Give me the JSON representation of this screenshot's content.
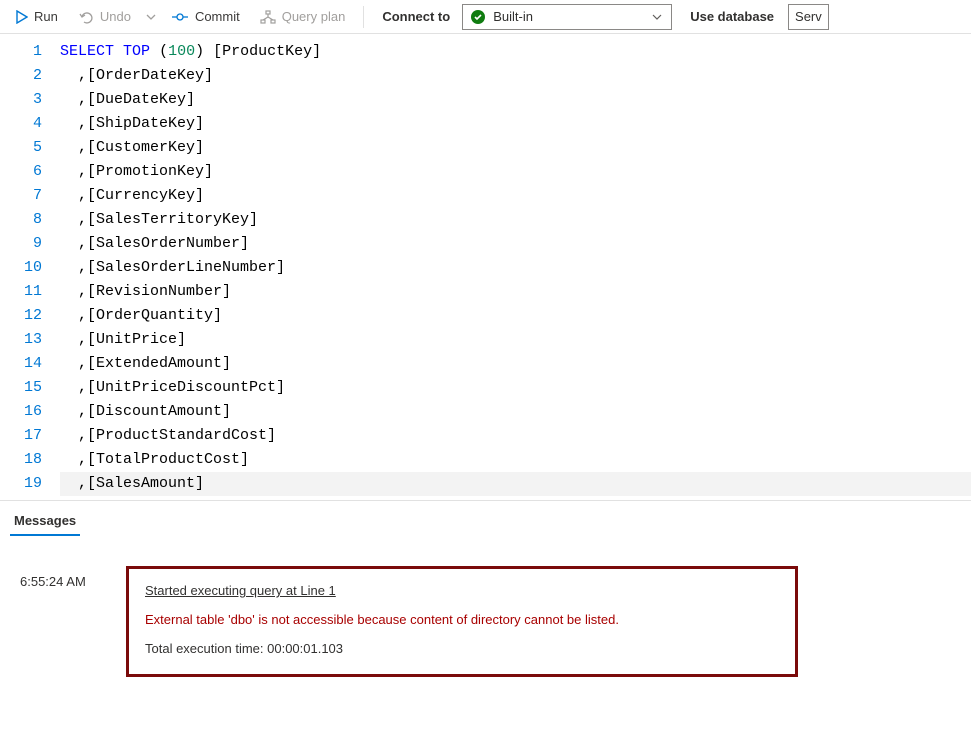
{
  "toolbar": {
    "run": "Run",
    "undo": "Undo",
    "commit": "Commit",
    "queryplan": "Query plan",
    "connect_label": "Connect to",
    "connect_value": "Built-in",
    "use_db_label": "Use database",
    "use_db_value": "Serv"
  },
  "editor": {
    "lines": [
      {
        "n": 1,
        "parts": [
          {
            "c": "kw-blue",
            "t": "SELECT"
          },
          {
            "c": "txt",
            "t": " "
          },
          {
            "c": "kw-blue",
            "t": "TOP"
          },
          {
            "c": "txt",
            "t": " "
          },
          {
            "c": "txt",
            "t": "("
          },
          {
            "c": "num",
            "t": "100"
          },
          {
            "c": "txt",
            "t": ") [ProductKey]"
          }
        ]
      },
      {
        "n": 2,
        "parts": [
          {
            "c": "txt",
            "t": "  ,[OrderDateKey]"
          }
        ]
      },
      {
        "n": 3,
        "parts": [
          {
            "c": "txt",
            "t": "  ,[DueDateKey]"
          }
        ]
      },
      {
        "n": 4,
        "parts": [
          {
            "c": "txt",
            "t": "  ,[ShipDateKey]"
          }
        ]
      },
      {
        "n": 5,
        "parts": [
          {
            "c": "txt",
            "t": "  ,[CustomerKey]"
          }
        ]
      },
      {
        "n": 6,
        "parts": [
          {
            "c": "txt",
            "t": "  ,[PromotionKey]"
          }
        ]
      },
      {
        "n": 7,
        "parts": [
          {
            "c": "txt",
            "t": "  ,[CurrencyKey]"
          }
        ]
      },
      {
        "n": 8,
        "parts": [
          {
            "c": "txt",
            "t": "  ,[SalesTerritoryKey]"
          }
        ]
      },
      {
        "n": 9,
        "parts": [
          {
            "c": "txt",
            "t": "  ,[SalesOrderNumber]"
          }
        ]
      },
      {
        "n": 10,
        "parts": [
          {
            "c": "txt",
            "t": "  ,[SalesOrderLineNumber]"
          }
        ]
      },
      {
        "n": 11,
        "parts": [
          {
            "c": "txt",
            "t": "  ,[RevisionNumber]"
          }
        ]
      },
      {
        "n": 12,
        "parts": [
          {
            "c": "txt",
            "t": "  ,[OrderQuantity]"
          }
        ]
      },
      {
        "n": 13,
        "parts": [
          {
            "c": "txt",
            "t": "  ,[UnitPrice]"
          }
        ]
      },
      {
        "n": 14,
        "parts": [
          {
            "c": "txt",
            "t": "  ,[ExtendedAmount]"
          }
        ]
      },
      {
        "n": 15,
        "parts": [
          {
            "c": "txt",
            "t": "  ,[UnitPriceDiscountPct]"
          }
        ]
      },
      {
        "n": 16,
        "parts": [
          {
            "c": "txt",
            "t": "  ,[DiscountAmount]"
          }
        ]
      },
      {
        "n": 17,
        "parts": [
          {
            "c": "txt",
            "t": "  ,[ProductStandardCost]"
          }
        ]
      },
      {
        "n": 18,
        "parts": [
          {
            "c": "txt",
            "t": "  ,[TotalProductCost]"
          }
        ]
      },
      {
        "n": 19,
        "parts": [
          {
            "c": "txt",
            "t": "  ,[SalesAmount]"
          }
        ],
        "current": true
      }
    ]
  },
  "results": {
    "tab_label": "Messages",
    "timestamp": "6:55:24 AM",
    "line1": "Started executing query at Line 1",
    "line2": "External table 'dbo' is not accessible because content of directory cannot be listed.",
    "line3": "Total execution time: 00:00:01.103"
  }
}
